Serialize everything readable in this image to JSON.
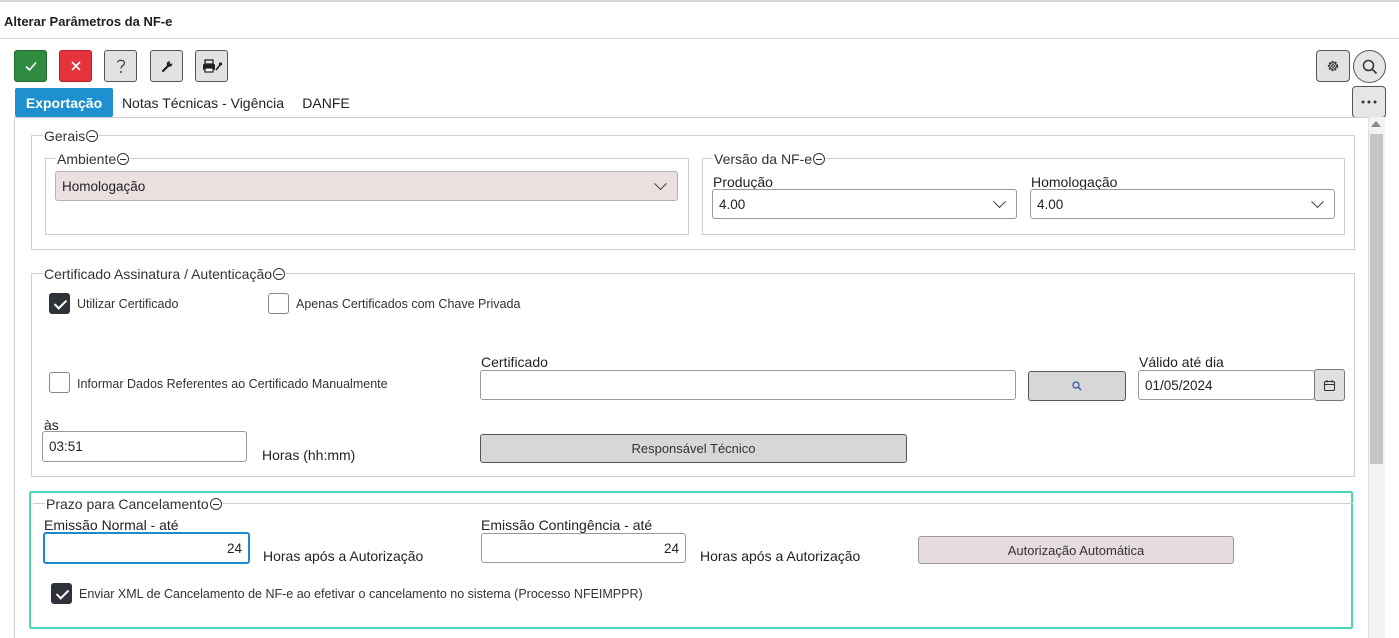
{
  "window": {
    "title": "Alterar Parâmetros da NF-e"
  },
  "toolbar": {
    "buttons": [
      {
        "name": "confirm-button",
        "icon": "check-icon"
      },
      {
        "name": "cancel-button",
        "icon": "close-icon"
      },
      {
        "name": "help-button",
        "icon": "question-icon"
      },
      {
        "name": "tools-button",
        "icon": "wrench-icon"
      },
      {
        "name": "print-button",
        "icon": "printer-icon"
      }
    ],
    "right_buttons": [
      "gear-icon",
      "search-icon",
      "more-icon"
    ],
    "accent_green": "#2e8b40",
    "accent_red": "#e5333b"
  },
  "tabs": [
    {
      "label": "Exportação",
      "active": true
    },
    {
      "label": "Notas Técnicas - Vigência",
      "active": false
    },
    {
      "label": "DANFE",
      "active": false
    }
  ],
  "gerais": {
    "legend": "Gerais",
    "ambiente": {
      "legend": "Ambiente",
      "value": "Homologação"
    },
    "versao": {
      "legend": "Versão da NF-e",
      "producao_label": "Produção",
      "producao_value": "4.00",
      "homologacao_label": "Homologação",
      "homologacao_value": "4.00"
    }
  },
  "certificado": {
    "legend": "Certificado Assinatura / Autenticação",
    "utilizar_label": "Utilizar Certificado",
    "utilizar_checked": true,
    "apenas_label": "Apenas Certificados com Chave Privada",
    "apenas_checked": false,
    "informar_label": "Informar Dados Referentes ao Certificado Manualmente",
    "informar_checked": false,
    "certificado_label": "Certificado",
    "certificado_value": "",
    "valido_label": "Válido até dia",
    "valido_value": "01/05/2024",
    "as_label": "às",
    "hora_value": "03:51",
    "horas_label": "Horas (hh:mm)",
    "responsavel_button": "Responsável Técnico"
  },
  "prazo": {
    "legend": "Prazo para Cancelamento",
    "normal_label": "Emissão Normal - até",
    "normal_value": "24",
    "normal_suffix": "Horas após a Autorização",
    "contingencia_label": "Emissão Contingência - até",
    "contingencia_value": "24",
    "contingencia_suffix": "Horas após a Autorização",
    "autorizacao_button": "Autorização Automática",
    "enviar_label": "Enviar XML de Cancelamento de NF-e ao efetivar o cancelamento no sistema (Processo NFEIMPPR)",
    "enviar_checked": true
  }
}
